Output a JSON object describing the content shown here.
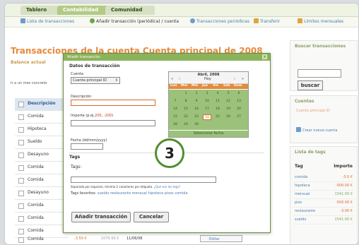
{
  "tabs": {
    "t1": "Tablero",
    "t2": "Contabilidad",
    "t3": "Comunidad"
  },
  "subnav": {
    "item1": "Lista de transacciones",
    "item2": "Añadir transacción (periódica) / cuenta",
    "item3": "Transacciones periódicas",
    "item4": "Transferir",
    "item5": "Límites mensuales"
  },
  "page": {
    "title": "Transacciones de la cuenta Cuenta principal de 2008",
    "subtitle": "Balance actual",
    "goto": "Ir a un mes concreto"
  },
  "list": {
    "header": "Descripción",
    "rows": [
      "Comida",
      "Hipoteca",
      "Sueldo",
      "Desayuno",
      "Comida",
      "Comida",
      "Desayuno",
      "Comida",
      "Comida",
      "Comida",
      "Comida"
    ],
    "last_amount": "-3.50 €",
    "last_balance": "1075.00 €",
    "last_date": "11/06/08",
    "edit_label": "Editar"
  },
  "dialog": {
    "bar_title": "Añadir transacción",
    "close": "x",
    "section_title": "Datos de transacción",
    "account_label": "Cuenta",
    "account_value": "Cuenta principal ID",
    "description_label": "Descripción",
    "amount_label": "Importe (p.ej.",
    "amount_hint1": "200",
    "amount_hint_sep": ", ",
    "amount_hint2": "-200",
    "amount_close": ")",
    "date_label": "Fecha (dd/mm/yyyy)",
    "tags_section": "Tags",
    "tags_label": "Tags:",
    "tags_hint": "Separado por espacios, mínimo 2 caracteres por etiqueta.",
    "tags_help": "¿Qué son los tags?",
    "fav_label": "Tags favoritos:",
    "fav_tags": "sueldo restaurante mensual hipoteca pisos comida",
    "submit": "Añadir transacción",
    "cancel": "Cancelar"
  },
  "calendar": {
    "month": "Abril, 2008",
    "today": "Hoy",
    "nav_prev2": "«",
    "nav_prev": "‹",
    "nav_next": "›",
    "nav_next2": "»",
    "dow": [
      "Lun",
      "Mar",
      "Mié",
      "Jue",
      "Vie",
      "Sáb",
      "Dom"
    ],
    "days": [
      [
        "",
        "1",
        "2",
        "3",
        "4",
        "5",
        "6"
      ],
      [
        "7",
        "8",
        "9",
        "10",
        "11",
        "12",
        "13"
      ],
      [
        "14",
        "15",
        "16",
        "17",
        "18",
        "19",
        "20"
      ],
      [
        "21",
        "22",
        "23",
        "24",
        "25",
        "26",
        "27"
      ],
      [
        "28",
        "29",
        "30",
        "",
        "",
        "",
        ""
      ]
    ],
    "selected": "24",
    "footer": "Seleccione fecha"
  },
  "sidebar": {
    "search_title": "Buscar transacciones",
    "search_button": "buscar",
    "accounts_title": "Cuentas",
    "accounts_item": "Cuenta principal ID",
    "create_account": "Crear nueva cuenta",
    "tags_title": "Lista de tags",
    "tag_col": "Tag",
    "amount_col": "Importe",
    "tags": [
      {
        "name": "comida",
        "value": "-3.0 €"
      },
      {
        "name": "hipoteca",
        "value": "-500.00 €"
      },
      {
        "name": "mensual",
        "value": "1541.00 €"
      },
      {
        "name": "piso",
        "value": "-500.00 €"
      },
      {
        "name": "restaurante",
        "value": "-3.00 €"
      },
      {
        "name": "sueldo",
        "value": "1541.00 €"
      }
    ]
  },
  "badge": "3",
  "colors": {
    "accent_green": "#8bb35b",
    "accent_orange": "#e68a3d",
    "link_blue": "#4a7bb3"
  }
}
